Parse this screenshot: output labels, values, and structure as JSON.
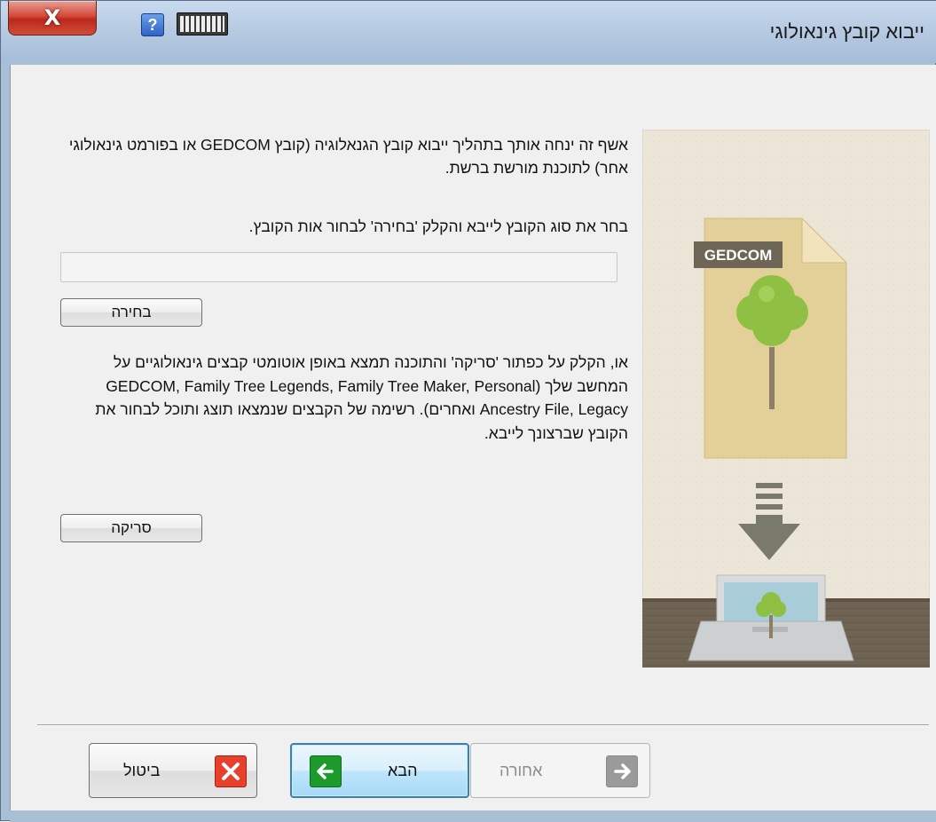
{
  "window": {
    "title": "ייבוא קובץ גינאולוגי",
    "close_label": "X",
    "help_label": "?"
  },
  "content": {
    "intro": "אשף זה ינחה אותך בתהליך ייבוא קובץ הגנאלוגיה (קובץ GEDCOM או בפורמט גינאולוגי אחר) לתוכנת מורשת ברשת.",
    "prompt": "בחר את סוג הקובץ לייבא והקלק 'בחירה' לבחור אות הקובץ.",
    "file_path_value": "",
    "choose_button": "בחירה",
    "scan_text": "או, הקלק על כפתור 'סריקה'  והתוכנה תמצא באופן אוטומטי קבצים גינאולוגיים על המחשב שלך (GEDCOM, Family Tree Legends, Family Tree Maker, Personal Ancestry File, Legacy ואחרים). רשימה של הקבצים שנמצאו תוצג ותוכל לבחור את הקובץ שברצונך לייבא.",
    "scan_button": "סריקה"
  },
  "illustration": {
    "file_badge": "GEDCOM"
  },
  "footer": {
    "cancel_label": "ביטול",
    "next_label": "הבא",
    "back_label": "אחורה"
  },
  "colors": {
    "title_bar": "#b7cbe2",
    "close_red": "#d5483a",
    "next_border": "#3c7fb1",
    "green_icon": "#1c9b2c",
    "red_icon": "#e8402b"
  }
}
